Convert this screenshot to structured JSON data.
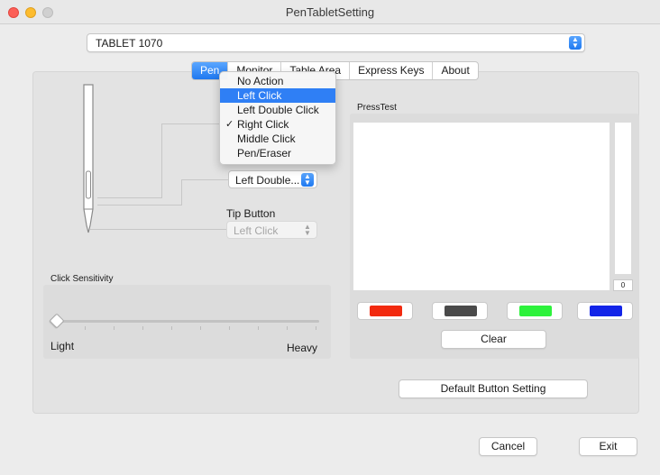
{
  "window": {
    "title": "PenTabletSetting"
  },
  "device": {
    "selected": "TABLET 1070"
  },
  "tabs": [
    {
      "label": "Pen",
      "active": true
    },
    {
      "label": "Monitor"
    },
    {
      "label": "Table Area"
    },
    {
      "label": "Express Keys"
    },
    {
      "label": "About"
    }
  ],
  "dropdown": {
    "items": [
      {
        "label": "No Action"
      },
      {
        "label": "Left Click",
        "highlighted": true
      },
      {
        "label": "Left Double Click"
      },
      {
        "label": "Right Click",
        "checked": true
      },
      {
        "label": "Middle Click"
      },
      {
        "label": "Pen/Eraser"
      }
    ],
    "check_glyph": "✓"
  },
  "pen_button_select": {
    "value": "Left Double..."
  },
  "tip_button": {
    "label": "Tip Button",
    "value": "Left Click"
  },
  "click_sensitivity": {
    "label": "Click Sensitivity",
    "min_label": "Light",
    "max_label": "Heavy",
    "level": 0
  },
  "press_test": {
    "label": "PressTest",
    "value": "0"
  },
  "colors": [
    {
      "name": "red",
      "hex": "#f22a0f"
    },
    {
      "name": "gray",
      "hex": "#4a4a4a"
    },
    {
      "name": "green",
      "hex": "#2df23c"
    },
    {
      "name": "blue",
      "hex": "#1224e8"
    }
  ],
  "buttons": {
    "clear": "Clear",
    "default_setting": "Default  Button Setting",
    "cancel": "Cancel",
    "exit": "Exit"
  },
  "accent": "#2f7ff5"
}
